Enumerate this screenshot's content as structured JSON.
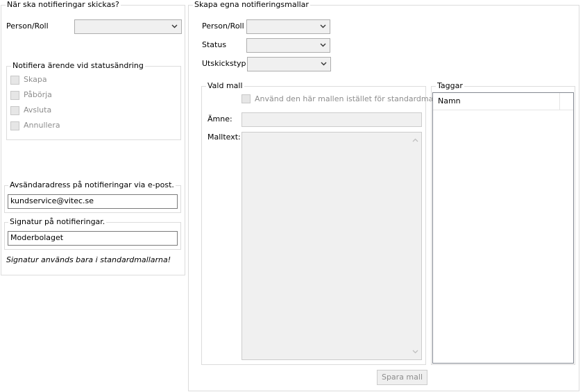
{
  "left_panel": {
    "title": "När ska notifieringar skickas?",
    "person_roll_label": "Person/Roll",
    "person_roll_value": "",
    "status_group": {
      "title": "Notifiera ärende vid statusändring",
      "options": [
        "Skapa",
        "Påbörja",
        "Avsluta",
        "Annullera"
      ]
    },
    "sender_group": {
      "title": "Avsändaradress på notifieringar via e-post.",
      "value": "kundservice@vitec.se"
    },
    "signature_group": {
      "title": "Signatur på notifieringar.",
      "value": "Moderbolaget"
    },
    "signature_note": "Signatur används bara i standardmallarna!"
  },
  "right_panel": {
    "title": "Skapa egna notifieringsmallar",
    "person_roll_label": "Person/Roll",
    "status_label": "Status",
    "utskickstyp_label": "Utskickstyp",
    "vald_mall": {
      "title": "Vald mall",
      "use_template_label": "Använd den här mallen istället för standardmallen",
      "amne_label": "Ämne:",
      "amne_value": "",
      "malltext_label": "Malltext:",
      "malltext_value": ""
    },
    "taggar": {
      "title": "Taggar",
      "column_header": "Namn"
    },
    "save_button": "Spara mall"
  },
  "colors": {
    "group_border": "#dcdcdc",
    "disabled_text": "#8d8d8d",
    "control_bg": "#f0f0f0"
  },
  "icons": {
    "combo_arrow": "chevron-down-icon",
    "scroll_up": "scroll-up-arrow-icon",
    "scroll_down": "scroll-down-arrow-icon"
  }
}
